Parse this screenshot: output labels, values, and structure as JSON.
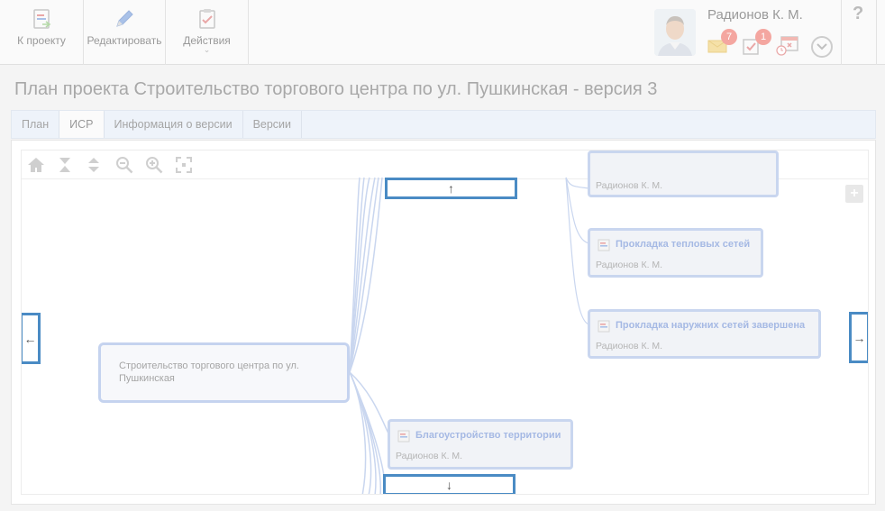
{
  "toolbar": {
    "to_project": "К проекту",
    "edit": "Редактировать",
    "actions": "Действия",
    "actions_chevron": "⌄"
  },
  "user": {
    "name": "Радионов К. М.",
    "messages_count": "7",
    "tasks_count": "1",
    "expand_icon": "chevron-down-icon"
  },
  "help": "?",
  "page": {
    "title": "План проекта Строительство торгового центра по ул. Пушкинская - версия 3"
  },
  "tabs": [
    {
      "label": "План"
    },
    {
      "label": "ИСР"
    },
    {
      "label": "Информация о версии"
    },
    {
      "label": "Версии"
    }
  ],
  "canvas_tools": [
    "home-icon",
    "collapse-icon",
    "expand-icon",
    "zoom-out-icon",
    "zoom-in-icon",
    "fit-screen-icon"
  ],
  "wbs": {
    "root": "Строительство торгового центра по ул. Пушкинская",
    "nodes": [
      {
        "title": "",
        "author": "Радионов К. М."
      },
      {
        "title": "Прокладка тепловых сетей",
        "author": "Радионов К. М."
      },
      {
        "title": "Прокладка наружних сетей завершена",
        "author": "Радионов К. М."
      },
      {
        "title": "Благоустройство территории",
        "author": "Радионов К. М."
      }
    ]
  },
  "nav": {
    "up": "↑",
    "down": "↓",
    "left": "←",
    "right": "→"
  },
  "colors": {
    "accent": "#4a8bc4",
    "node_border": "#c9d6ef",
    "node_title": "#a5b9e4",
    "badge": "#f4a6a0"
  }
}
